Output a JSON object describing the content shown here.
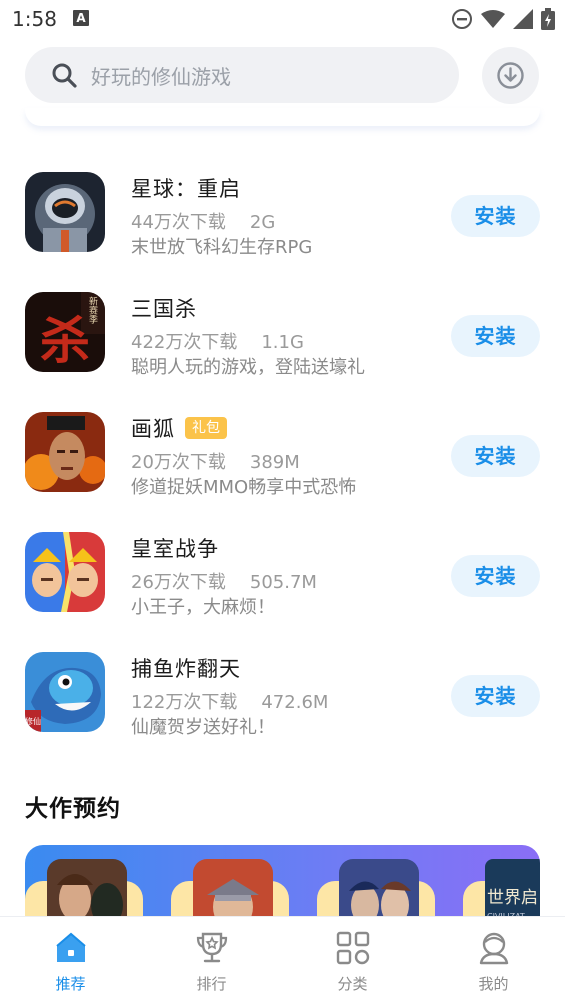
{
  "status_bar": {
    "time": "1:58",
    "notification_glyph": "A",
    "icons": [
      "do-not-disturb-icon",
      "wifi-icon",
      "signal-icon",
      "battery-icon"
    ]
  },
  "search": {
    "placeholder": "好玩的修仙游戏",
    "icon": "search-icon"
  },
  "download_button": {
    "icon": "download-icon"
  },
  "apps": [
    {
      "name": "星球：重启",
      "badge": "",
      "downloads": "44万次下载",
      "size": "2G",
      "desc": "末世放飞科幻生存RPG",
      "button": "安装",
      "icon": "xingqiu-app-icon"
    },
    {
      "name": "三国杀",
      "badge": "",
      "downloads": "422万次下载",
      "size": "1.1G",
      "desc": "聪明人玩的游戏，登陆送壕礼",
      "button": "安装",
      "icon": "sanguosha-app-icon",
      "icon_text": "杀",
      "icon_tag": "新赛季"
    },
    {
      "name": "画狐",
      "badge": "礼包",
      "downloads": "20万次下载",
      "size": "389M",
      "desc": "修道捉妖MMO畅享中式恐怖",
      "button": "安装",
      "icon": "huahu-app-icon"
    },
    {
      "name": "皇室战争",
      "badge": "",
      "downloads": "26万次下载",
      "size": "505.7M",
      "desc": "小王子，大麻烦！",
      "button": "安装",
      "icon": "clash-royale-app-icon"
    },
    {
      "name": "捕鱼炸翻天",
      "badge": "",
      "downloads": "122万次下载",
      "size": "472.6M",
      "desc": "仙魔贺岁送好礼！",
      "button": "安装",
      "icon": "fishing-app-icon",
      "icon_text": "修仙"
    }
  ],
  "section": {
    "title": "大作预约"
  },
  "banner": {
    "last_thumb_text": "世界启",
    "last_thumb_sub": "CIVILIZAT"
  },
  "colors": {
    "accent": "#1a8ee8",
    "install_bg": "#e8f4fd",
    "badge": "#fbc34a"
  },
  "bottom_nav": [
    {
      "label": "推荐",
      "icon": "home-icon",
      "active": true
    },
    {
      "label": "排行",
      "icon": "trophy-icon",
      "active": false
    },
    {
      "label": "分类",
      "icon": "category-grid-icon",
      "active": false
    },
    {
      "label": "我的",
      "icon": "profile-icon",
      "active": false
    }
  ]
}
